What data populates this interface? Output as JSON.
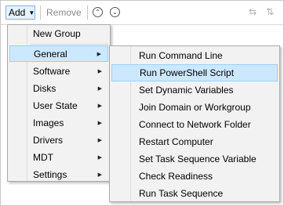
{
  "toolbar": {
    "add_label": "Add",
    "add_dropdown_icon": "caret-down",
    "remove_label": "Remove",
    "move_up_icon": "double-chevron-up",
    "move_down_icon": "double-chevron-down",
    "icon_a": "group-icon",
    "icon_b": "ungroup-icon"
  },
  "add_menu": {
    "items": [
      {
        "label": "New Group",
        "submenu": false
      },
      {
        "label": "General",
        "submenu": true,
        "highlighted": true
      },
      {
        "label": "Software",
        "submenu": true
      },
      {
        "label": "Disks",
        "submenu": true
      },
      {
        "label": "User State",
        "submenu": true
      },
      {
        "label": "Images",
        "submenu": true
      },
      {
        "label": "Drivers",
        "submenu": true
      },
      {
        "label": "MDT",
        "submenu": true
      },
      {
        "label": "Settings",
        "submenu": true
      }
    ]
  },
  "general_submenu": {
    "items": [
      {
        "label": "Run Command Line"
      },
      {
        "label": "Run PowerShell Script",
        "highlighted": true
      },
      {
        "label": "Set Dynamic Variables"
      },
      {
        "label": "Join Domain or Workgroup"
      },
      {
        "label": "Connect to Network Folder"
      },
      {
        "label": "Restart Computer"
      },
      {
        "label": "Set Task Sequence Variable"
      },
      {
        "label": "Check Readiness"
      },
      {
        "label": "Run Task Sequence"
      }
    ]
  },
  "colors": {
    "highlight_bg": "#cce8ff",
    "highlight_border": "#99d1ff",
    "menu_bg": "#f2f2f2"
  }
}
